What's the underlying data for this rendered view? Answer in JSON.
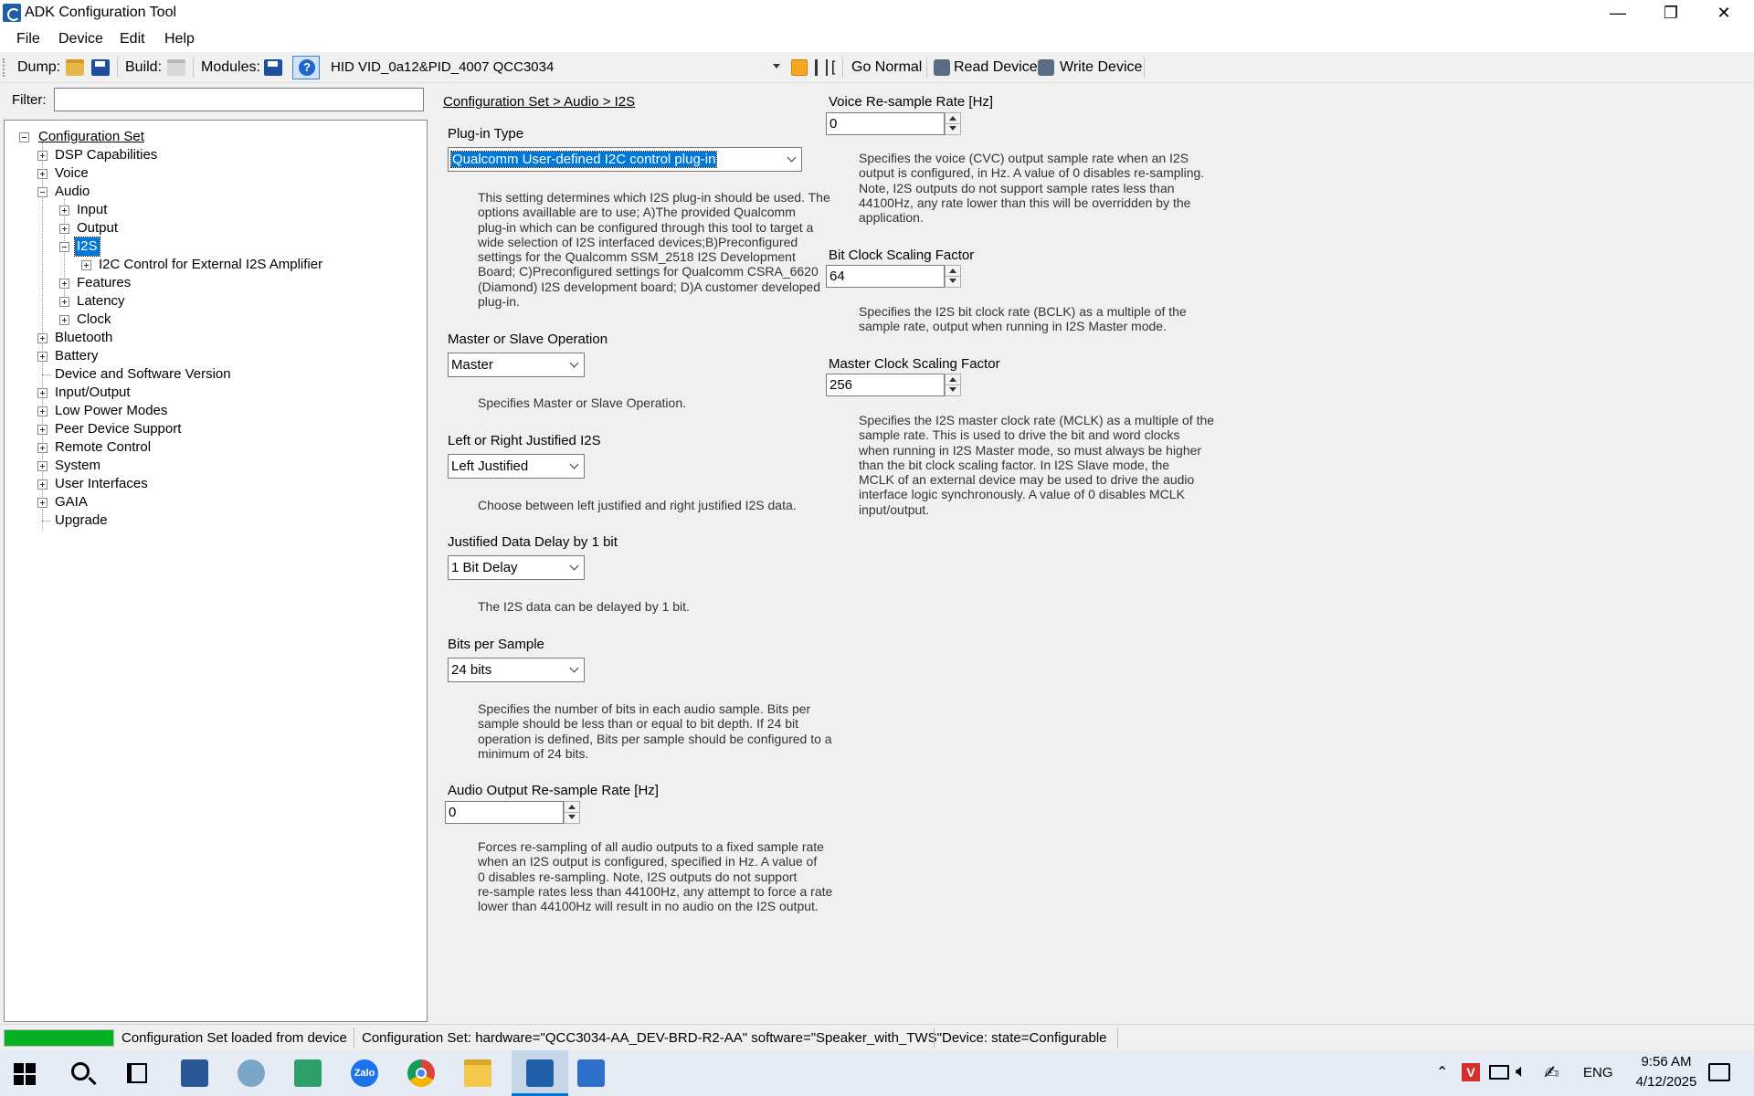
{
  "window": {
    "title": "ADK Configuration Tool",
    "minimize_glyph": "—",
    "maximize_glyph": "❐",
    "close_glyph": "✕",
    "app_icon": "adk-app-icon"
  },
  "menu": [
    "File",
    "Device",
    "Edit",
    "Help"
  ],
  "toolbar": {
    "dump_label": "Dump:",
    "build_label": "Build:",
    "modules_label": "Modules:",
    "help_glyph": "?",
    "device": "HID VID_0a12&PID_4007 QCC3034",
    "trailing_glyph": "[",
    "go_normal": "Go Normal",
    "read_device": "Read Device",
    "write_device": "Write Device"
  },
  "filter": {
    "label": "Filter:",
    "value": ""
  },
  "tree": {
    "root": "Configuration Set",
    "dsp": "DSP Capabilities",
    "voice": "Voice",
    "audio": "Audio",
    "input": "Input",
    "output": "Output",
    "i2s": "I2S",
    "i2c": "I2C Control for External I2S Amplifier",
    "features": "Features",
    "latency": "Latency",
    "clock": "Clock",
    "bluetooth": "Bluetooth",
    "battery": "Battery",
    "device_sw": "Device and Software Version",
    "io": "Input/Output",
    "lowpower": "Low Power Modes",
    "peer": "Peer Device Support",
    "remote": "Remote Control",
    "system": "System",
    "ui": "User Interfaces",
    "gaia": "GAIA",
    "upgrade": "Upgrade"
  },
  "breadcrumb": "Configuration Set > Audio > I2S",
  "plugin": {
    "label": "Plug-in Type",
    "value": "Qualcomm User-defined I2C control plug-in",
    "desc": [
      "This setting determines which I2S plug-in should be used. The",
      "options availlable are to use; A)The provided Qualcomm",
      "plug-in which can be configured through this tool to target a",
      "wide selection of I2S interfaced devices;B)Preconfigured",
      "settings for the Qualcomm SSM_2518 I2S Development",
      "Board; C)Preconfigured settings for Qualcomm CSRA_6620",
      "(Diamond) I2S development board; D)A customer developed",
      "plug-in."
    ]
  },
  "master_slave": {
    "label": "Master or Slave Operation",
    "value": "Master",
    "desc": "Specifies Master or Slave Operation."
  },
  "justified": {
    "label": "Left or Right Justified I2S",
    "value": "Left Justified",
    "desc": "Choose between left justified and right justified I2S data."
  },
  "delay": {
    "label": "Justified Data Delay by 1 bit",
    "value": "1 Bit Delay",
    "desc": "The I2S data can be delayed by 1 bit."
  },
  "bits": {
    "label": "Bits per Sample",
    "value": "24 bits",
    "desc": [
      "Specifies the number of bits in each audio sample. Bits per",
      "sample should be less than or equal to bit depth. If 24 bit",
      "operation is defined, Bits per sample should be configured to a",
      "minimum of 24 bits."
    ]
  },
  "audio_resample": {
    "label": "Audio Output Re-sample Rate [Hz]",
    "value": "0",
    "desc": [
      "Forces re-sampling of all audio outputs to a fixed sample rate",
      "when an I2S output is configured, specified in Hz. A value of",
      "0 disables re-sampling. Note, I2S outputs do not support",
      "re-sample rates less than 44100Hz, any attempt to force a rate",
      "lower than 44100Hz will result in no audio on the I2S output."
    ]
  },
  "voice_resample": {
    "label": "Voice Re-sample Rate [Hz]",
    "value": "0",
    "desc": [
      "Specifies the voice (CVC) output sample rate when an I2S",
      "output is configured, in Hz. A value of 0 disables re-sampling.",
      "Note, I2S outputs do not support sample rates less than",
      "44100Hz, any rate lower than this will be overridden by the",
      "application."
    ]
  },
  "bclk": {
    "label": "Bit Clock Scaling Factor",
    "value": "64",
    "desc": [
      "Specifies the I2S bit clock rate (BCLK) as a multiple of the",
      "sample rate, output when running in I2S Master mode."
    ]
  },
  "mclk": {
    "label": "Master Clock Scaling Factor",
    "value": "256",
    "desc": [
      "Specifies the I2S master clock rate (MCLK) as a multiple of the",
      "sample rate. This is used to drive the bit and word clocks",
      "when running in I2S Master mode, so must always be higher",
      "than the bit clock scaling factor. In I2S Slave mode, the",
      "MCLK of an external device may be used to drive the audio",
      "interface logic synchronously. A value of 0 disables MCLK",
      "input/output."
    ]
  },
  "status": {
    "progress": 1.0,
    "message": "Configuration Set loaded from device",
    "config": "Configuration Set:  hardware=\"QCC3034-AA_DEV-BRD-R2-AA\" software=\"Speaker_with_TWS\"",
    "device": "Device:  state=Configurable"
  },
  "taskbar": {
    "lang": "ENG",
    "time": "9:56 AM",
    "date": "4/12/2025",
    "zalo": "Zalo"
  },
  "colors": {
    "accent": "#0078d7",
    "progress": "#06b025",
    "taskbar": "#e6ecf5"
  }
}
